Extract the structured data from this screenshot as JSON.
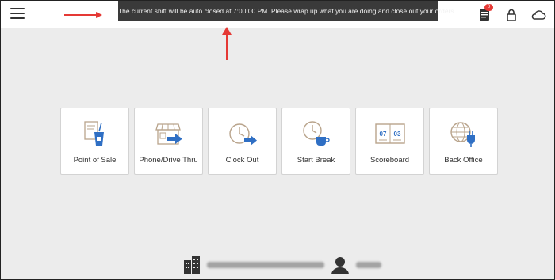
{
  "toast": {
    "message": "The current shift will be auto closed at 7:00:00 PM. Please wrap up what you are doing and close out your orders."
  },
  "header": {
    "orders_badge": "0",
    "icons": [
      "menu-icon",
      "clipboard-icon",
      "lock-icon",
      "cloud-icon"
    ]
  },
  "tiles": [
    {
      "label": "Point of Sale",
      "icon": "drink-receipt-icon"
    },
    {
      "label": "Phone/Drive Thru",
      "icon": "storefront-arrow-icon"
    },
    {
      "label": "Clock Out",
      "icon": "clock-arrow-icon"
    },
    {
      "label": "Start Break",
      "icon": "clock-coffee-icon"
    },
    {
      "label": "Scoreboard",
      "icon": "scoreboard-icon",
      "digits_left": "07",
      "digits_right": "03"
    },
    {
      "label": "Back Office",
      "icon": "globe-plug-icon"
    }
  ],
  "colors": {
    "accent_blue": "#2f6fc4",
    "toast_bg": "#3a3a3a",
    "badge_red": "#e53935",
    "annotation_red": "#e53935"
  }
}
